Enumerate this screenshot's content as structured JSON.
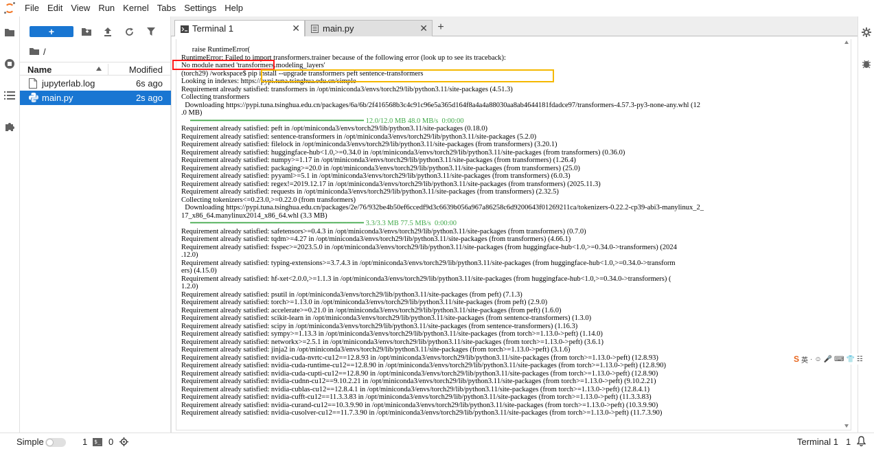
{
  "menu": [
    "File",
    "Edit",
    "View",
    "Run",
    "Kernel",
    "Tabs",
    "Settings",
    "Help"
  ],
  "colors": {
    "accent": "#1976d2",
    "jupyter_orange": "#f37726",
    "terminal_progress_green": "#41a84a",
    "annotation_red": "#ff1a1a",
    "annotation_orange": "#f5b800"
  },
  "left_rail_icons": [
    "folder-icon",
    "running-icon",
    "toc-icon",
    "extension-icon"
  ],
  "file_browser": {
    "new_label": "+",
    "toolbar_icons": [
      "new-folder-icon",
      "upload-icon",
      "refresh-icon",
      "filter-icon"
    ],
    "breadcrumb": "/",
    "header": {
      "name": "Name",
      "modified": "Modified"
    },
    "files": [
      {
        "name": "jupyterlab.log",
        "modified": "6s ago",
        "icon": "text-file-icon",
        "selected": false
      },
      {
        "name": "main.py",
        "modified": "2s ago",
        "icon": "python-file-icon",
        "selected": true
      }
    ]
  },
  "tabs": [
    {
      "label": "Terminal 1",
      "icon": "terminal-icon",
      "active": true
    },
    {
      "label": "main.py",
      "icon": "file-icon",
      "active": false
    }
  ],
  "tab_add": "+",
  "terminal": {
    "lines": [
      "      raise RuntimeError(",
      "RuntimeError: Failed to import transformers.trainer because of the following error (look up to see its traceback):",
      "No module named 'transformers.modeling_layers'",
      "(torch29) /workspace$ pip install --upgrade transformers peft sentence-transformers",
      "Looking in indexes: https://pypi.tuna.tsinghua.edu.cn/simple",
      "Requirement already satisfied: transformers in /opt/miniconda3/envs/torch29/lib/python3.11/site-packages (4.51.3)",
      "Collecting transformers",
      "  Downloading https://pypi.tuna.tsinghua.edu.cn/packages/6a/6b/2f416568b3c4c91c96e5a365d164f8a4a4a88030aa8ab4644181fdadce97/transformers-4.57.3-py3-none-any.whl (12",
      ".0 MB)",
      "     ━━━━━━━━━━━━━━━━━━━━━━━━━━━━━━━━━━━━━━━━ 12.0/12.0 MB 48.0 MB/s  0:00:00",
      "Requirement already satisfied: peft in /opt/miniconda3/envs/torch29/lib/python3.11/site-packages (0.18.0)",
      "Requirement already satisfied: sentence-transformers in /opt/miniconda3/envs/torch29/lib/python3.11/site-packages (5.2.0)",
      "Requirement already satisfied: filelock in /opt/miniconda3/envs/torch29/lib/python3.11/site-packages (from transformers) (3.20.1)",
      "Requirement already satisfied: huggingface-hub<1.0,>=0.34.0 in /opt/miniconda3/envs/torch29/lib/python3.11/site-packages (from transformers) (0.36.0)",
      "Requirement already satisfied: numpy>=1.17 in /opt/miniconda3/envs/torch29/lib/python3.11/site-packages (from transformers) (1.26.4)",
      "Requirement already satisfied: packaging>=20.0 in /opt/miniconda3/envs/torch29/lib/python3.11/site-packages (from transformers) (25.0)",
      "Requirement already satisfied: pyyaml>=5.1 in /opt/miniconda3/envs/torch29/lib/python3.11/site-packages (from transformers) (6.0.3)",
      "Requirement already satisfied: regex!=2019.12.17 in /opt/miniconda3/envs/torch29/lib/python3.11/site-packages (from transformers) (2025.11.3)",
      "Requirement already satisfied: requests in /opt/miniconda3/envs/torch29/lib/python3.11/site-packages (from transformers) (2.32.5)",
      "Collecting tokenizers<=0.23.0,>=0.22.0 (from transformers)",
      "  Downloading https://pypi.tuna.tsinghua.edu.cn/packages/2e/76/932be4b50ef6ccedf9d3c6639b056a967a86258c6d9200643f01269211ca/tokenizers-0.22.2-cp39-abi3-manylinux_2_",
      "17_x86_64.manylinux2014_x86_64.whl (3.3 MB)",
      "     ━━━━━━━━━━━━━━━━━━━━━━━━━━━━━━━━━━━━━━━━ 3.3/3.3 MB 77.5 MB/s  0:00:00",
      "Requirement already satisfied: safetensors>=0.4.3 in /opt/miniconda3/envs/torch29/lib/python3.11/site-packages (from transformers) (0.7.0)",
      "Requirement already satisfied: tqdm>=4.27 in /opt/miniconda3/envs/torch29/lib/python3.11/site-packages (from transformers) (4.66.1)",
      "Requirement already satisfied: fsspec>=2023.5.0 in /opt/miniconda3/envs/torch29/lib/python3.11/site-packages (from huggingface-hub<1.0,>=0.34.0->transformers) (2024",
      ".12.0)",
      "Requirement already satisfied: typing-extensions>=3.7.4.3 in /opt/miniconda3/envs/torch29/lib/python3.11/site-packages (from huggingface-hub<1.0,>=0.34.0->transform",
      "ers) (4.15.0)",
      "Requirement already satisfied: hf-xet<2.0.0,>=1.1.3 in /opt/miniconda3/envs/torch29/lib/python3.11/site-packages (from huggingface-hub<1.0,>=0.34.0->transformers) (",
      "1.2.0)",
      "Requirement already satisfied: psutil in /opt/miniconda3/envs/torch29/lib/python3.11/site-packages (from peft) (7.1.3)",
      "Requirement already satisfied: torch>=1.13.0 in /opt/miniconda3/envs/torch29/lib/python3.11/site-packages (from peft) (2.9.0)",
      "Requirement already satisfied: accelerate>=0.21.0 in /opt/miniconda3/envs/torch29/lib/python3.11/site-packages (from peft) (1.6.0)",
      "Requirement already satisfied: scikit-learn in /opt/miniconda3/envs/torch29/lib/python3.11/site-packages (from sentence-transformers) (1.3.0)",
      "Requirement already satisfied: scipy in /opt/miniconda3/envs/torch29/lib/python3.11/site-packages (from sentence-transformers) (1.16.3)",
      "Requirement already satisfied: sympy>=1.13.3 in /opt/miniconda3/envs/torch29/lib/python3.11/site-packages (from torch>=1.13.0->peft) (1.14.0)",
      "Requirement already satisfied: networkx>=2.5.1 in /opt/miniconda3/envs/torch29/lib/python3.11/site-packages (from torch>=1.13.0->peft) (3.6.1)",
      "Requirement already satisfied: jinja2 in /opt/miniconda3/envs/torch29/lib/python3.11/site-packages (from torch>=1.13.0->peft) (3.1.6)",
      "Requirement already satisfied: nvidia-cuda-nvrtc-cu12==12.8.93 in /opt/miniconda3/envs/torch29/lib/python3.11/site-packages (from torch>=1.13.0->peft) (12.8.93)",
      "Requirement already satisfied: nvidia-cuda-runtime-cu12==12.8.90 in /opt/miniconda3/envs/torch29/lib/python3.11/site-packages (from torch>=1.13.0->peft) (12.8.90)",
      "Requirement already satisfied: nvidia-cuda-cupti-cu12==12.8.90 in /opt/miniconda3/envs/torch29/lib/python3.11/site-packages (from torch>=1.13.0->peft) (12.8.90)",
      "Requirement already satisfied: nvidia-cudnn-cu12==9.10.2.21 in /opt/miniconda3/envs/torch29/lib/python3.11/site-packages (from torch>=1.13.0->peft) (9.10.2.21)",
      "Requirement already satisfied: nvidia-cublas-cu12==12.8.4.1 in /opt/miniconda3/envs/torch29/lib/python3.11/site-packages (from torch>=1.13.0->peft) (12.8.4.1)",
      "Requirement already satisfied: nvidia-cufft-cu12==11.3.3.83 in /opt/miniconda3/envs/torch29/lib/python3.11/site-packages (from torch>=1.13.0->peft) (11.3.3.83)",
      "Requirement already satisfied: nvidia-curand-cu12==10.3.9.90 in /opt/miniconda3/envs/torch29/lib/python3.11/site-packages (from torch>=1.13.0->peft) (10.3.9.90)",
      "Requirement already satisfied: nvidia-cusolver-cu12==11.7.3.90 in /opt/miniconda3/envs/torch29/lib/python3.11/site-packages (from torch>=1.13.0->peft) (11.7.3.90)"
    ]
  },
  "right_rail_icons": [
    "property-inspector-icon",
    "debugger-icon"
  ],
  "ime_toolbar": {
    "logo": "S",
    "items": [
      "英",
      "·",
      "☺",
      "🎤",
      "⌨",
      "👕",
      "☷"
    ]
  },
  "statusbar": {
    "simple_label": "Simple",
    "terminals_count": "1",
    "terminal_icon_text": "$_",
    "kernels_count": "0",
    "right_label": "Terminal 1",
    "notification_count": "1"
  }
}
